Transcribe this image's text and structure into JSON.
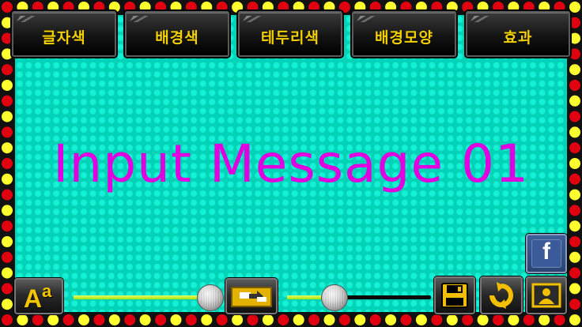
{
  "menu": {
    "text_color_label": "글자색",
    "bg_color_label": "배경색",
    "border_color_label": "테두리색",
    "bg_shape_label": "배경모양",
    "effect_label": "효과"
  },
  "message": {
    "text": "Input Message 01"
  },
  "controls": {
    "font_icon_big": "A",
    "font_icon_small": "a",
    "size_slider_level": 0.93,
    "speed_slider_level": 0.33,
    "facebook_letter": "f"
  },
  "colors": {
    "text": "#e000e0",
    "background": "#00e0c4",
    "border_red": "#e00010",
    "border_yellow": "#ffff30",
    "menu_label": "#f5d000",
    "slider_fill": "#c8ff20"
  }
}
